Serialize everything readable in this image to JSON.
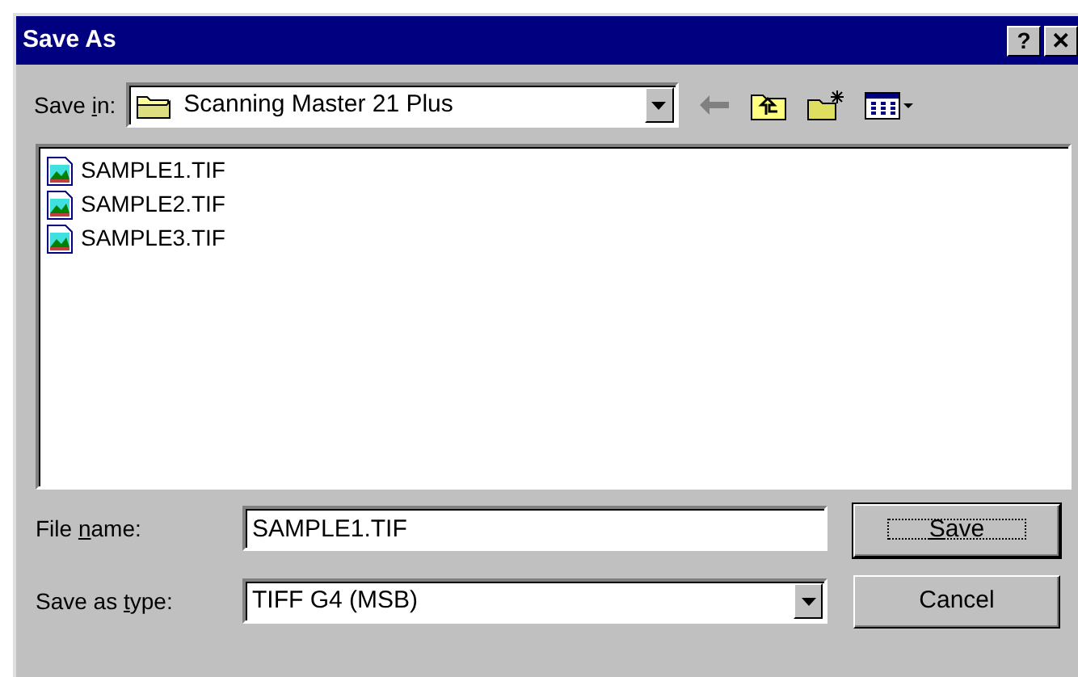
{
  "window": {
    "title": "Save As",
    "buttons": [
      {
        "kind": "help",
        "label": "?"
      },
      {
        "kind": "close",
        "label": "✕"
      }
    ]
  },
  "save_in": {
    "label": [
      {
        "kind": "plain",
        "text": "Save "
      },
      {
        "kind": "access-key",
        "text": "i"
      },
      {
        "kind": "plain",
        "text": "n:"
      }
    ],
    "value": "Scanning Master 21 Plus",
    "toolbar": [
      {
        "kind": "back",
        "disabled": true
      },
      {
        "kind": "up",
        "disabled": false
      },
      {
        "kind": "new-folder",
        "disabled": false
      },
      {
        "kind": "view-menu",
        "disabled": false
      }
    ]
  },
  "files": [
    {
      "name": "SAMPLE1.TIF"
    },
    {
      "name": "SAMPLE2.TIF"
    },
    {
      "name": "SAMPLE3.TIF"
    }
  ],
  "file_name": {
    "label": [
      {
        "kind": "plain",
        "text": "File "
      },
      {
        "kind": "access-key",
        "text": "n"
      },
      {
        "kind": "plain",
        "text": "ame:"
      }
    ],
    "value": "SAMPLE1.TIF"
  },
  "save_as_type": {
    "label": [
      {
        "kind": "plain",
        "text": "Save as "
      },
      {
        "kind": "access-key",
        "text": "t"
      },
      {
        "kind": "plain",
        "text": "ype:"
      }
    ],
    "value": "TIFF G4 (MSB)"
  },
  "buttons": [
    {
      "label": [
        {
          "kind": "access-key",
          "text": "S"
        },
        {
          "kind": "plain",
          "text": "ave"
        }
      ],
      "default": true
    },
    {
      "label": [
        {
          "kind": "plain",
          "text": "Cancel"
        }
      ],
      "default": false
    }
  ]
}
